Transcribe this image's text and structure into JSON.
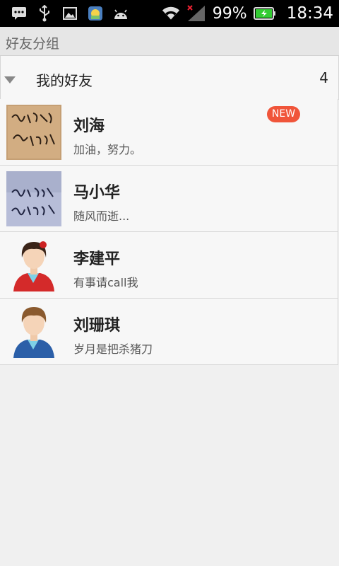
{
  "status_bar": {
    "battery_text": "99%",
    "time": "18:34",
    "icons": [
      "message-icon",
      "usb-icon",
      "image-icon",
      "app-icon",
      "android-icon",
      "wifi-icon",
      "signal-icon",
      "battery-charging-icon"
    ]
  },
  "section": {
    "title": "好友分组"
  },
  "group": {
    "name": "我的好友",
    "count": "4"
  },
  "friends": [
    {
      "name": "刘海",
      "signature": "加油，努力。",
      "badge": "NEW",
      "avatar": "handwriting-photo-1"
    },
    {
      "name": "马小华",
      "signature": "随风而逝...",
      "avatar": "handwriting-photo-2"
    },
    {
      "name": "李建平",
      "signature": "有事请call我",
      "avatar": "female-person-icon"
    },
    {
      "name": "刘珊琪",
      "signature": "岁月是把杀猪刀",
      "avatar": "male-person-icon"
    }
  ],
  "colors": {
    "badge": "#f0553a",
    "status_bar": "#000000",
    "battery_charging": "#33cc33"
  }
}
